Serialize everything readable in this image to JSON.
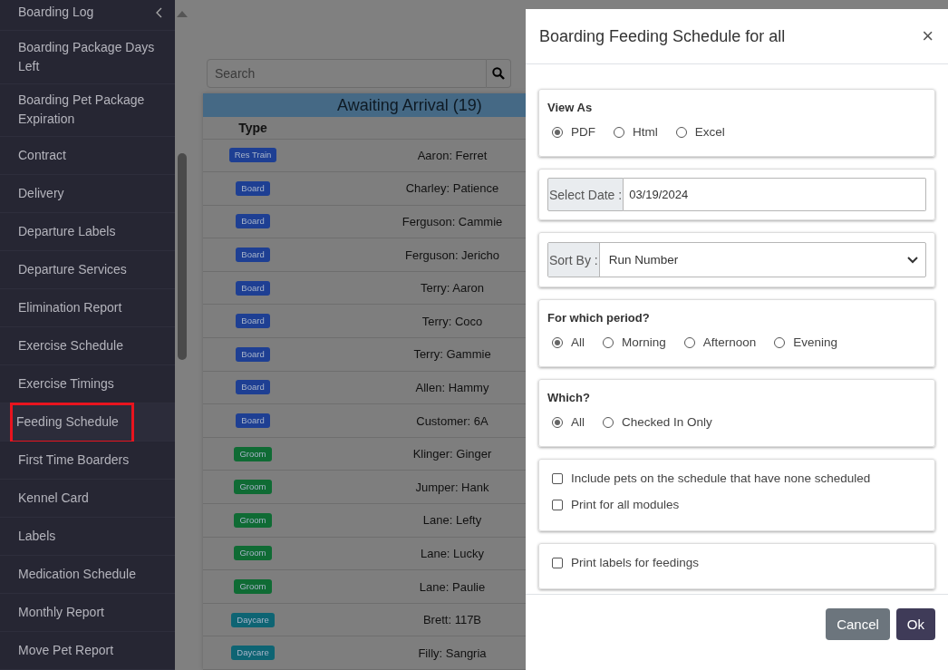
{
  "sidebar": {
    "items": [
      {
        "label": "Boarding Log",
        "selected": false
      },
      {
        "label": "Boarding Package Days Left",
        "selected": false
      },
      {
        "label": "Boarding Pet Package Expiration",
        "selected": false
      },
      {
        "label": "Contract",
        "selected": false
      },
      {
        "label": "Delivery",
        "selected": false
      },
      {
        "label": "Departure Labels",
        "selected": false
      },
      {
        "label": "Departure Services",
        "selected": false
      },
      {
        "label": "Elimination Report",
        "selected": false
      },
      {
        "label": "Exercise Schedule",
        "selected": false
      },
      {
        "label": "Exercise Timings",
        "selected": false
      },
      {
        "label": "Feeding Schedule",
        "selected": true
      },
      {
        "label": "First Time Boarders",
        "selected": false
      },
      {
        "label": "Kennel Card",
        "selected": false
      },
      {
        "label": "Labels",
        "selected": false
      },
      {
        "label": "Medication Schedule",
        "selected": false
      },
      {
        "label": "Monthly Report",
        "selected": false
      },
      {
        "label": "Move Pet Report",
        "selected": false
      }
    ]
  },
  "search": {
    "placeholder": "Search"
  },
  "table": {
    "title": "Awaiting Arrival (19)",
    "columns": [
      "Type"
    ],
    "rows": [
      {
        "type": "Res Train",
        "color": "#1e3f93",
        "name": "Aaron: Ferret"
      },
      {
        "type": "Board",
        "color": "#1e3f93",
        "name": "Charley: Patience"
      },
      {
        "type": "Board",
        "color": "#1e3f93",
        "name": "Ferguson: Cammie"
      },
      {
        "type": "Board",
        "color": "#1e3f93",
        "name": "Ferguson: Jericho"
      },
      {
        "type": "Board",
        "color": "#1e3f93",
        "name": "Terry: Aaron"
      },
      {
        "type": "Board",
        "color": "#1e3f93",
        "name": "Terry: Coco"
      },
      {
        "type": "Board",
        "color": "#1e3f93",
        "name": "Terry: Gammie"
      },
      {
        "type": "Board",
        "color": "#1e3f93",
        "name": "Allen: Hammy"
      },
      {
        "type": "Board",
        "color": "#1e3f93",
        "name": "Customer: 6A"
      },
      {
        "type": "Groom",
        "color": "#0f6b34",
        "name": "Klinger: Ginger"
      },
      {
        "type": "Groom",
        "color": "#0f6b34",
        "name": "Jumper: Hank"
      },
      {
        "type": "Groom",
        "color": "#0f6b34",
        "name": "Lane: Lefty"
      },
      {
        "type": "Groom",
        "color": "#0f6b34",
        "name": "Lane: Lucky"
      },
      {
        "type": "Groom",
        "color": "#0f6b34",
        "name": "Lane: Paulie"
      },
      {
        "type": "Daycare",
        "color": "#0e6473",
        "name": "Brett: 117B"
      },
      {
        "type": "Daycare",
        "color": "#0e6473",
        "name": "Filly: Sangria"
      }
    ]
  },
  "modal": {
    "title": "Boarding Feeding Schedule for all",
    "close": "×",
    "sections": [
      {
        "kind": "radio",
        "label": "View As",
        "options": [
          {
            "label": "PDF",
            "selected": true
          },
          {
            "label": "Html",
            "selected": false
          },
          {
            "label": "Excel",
            "selected": false
          }
        ]
      },
      {
        "kind": "input",
        "label": "Select Date :",
        "value": "03/19/2024"
      },
      {
        "kind": "select",
        "label": "Sort By :",
        "value": "Run Number"
      },
      {
        "kind": "radio",
        "label": "For which period?",
        "options": [
          {
            "label": "All",
            "selected": true
          },
          {
            "label": "Morning",
            "selected": false
          },
          {
            "label": "Afternoon",
            "selected": false
          },
          {
            "label": "Evening",
            "selected": false
          }
        ]
      },
      {
        "kind": "radio",
        "label": "Which?",
        "options": [
          {
            "label": "All",
            "selected": true
          },
          {
            "label": "Checked In Only",
            "selected": false
          }
        ]
      },
      {
        "kind": "checkboxes",
        "options": [
          {
            "label": "Include pets on the schedule that have none scheduled",
            "checked": false
          },
          {
            "label": "Print for all modules",
            "checked": false
          }
        ]
      },
      {
        "kind": "checkboxes",
        "options": [
          {
            "label": "Print labels for feedings",
            "checked": false
          }
        ]
      }
    ],
    "buttons": [
      {
        "label": "Cancel",
        "kind": "secondary"
      },
      {
        "label": "Ok",
        "kind": "primary"
      }
    ]
  }
}
